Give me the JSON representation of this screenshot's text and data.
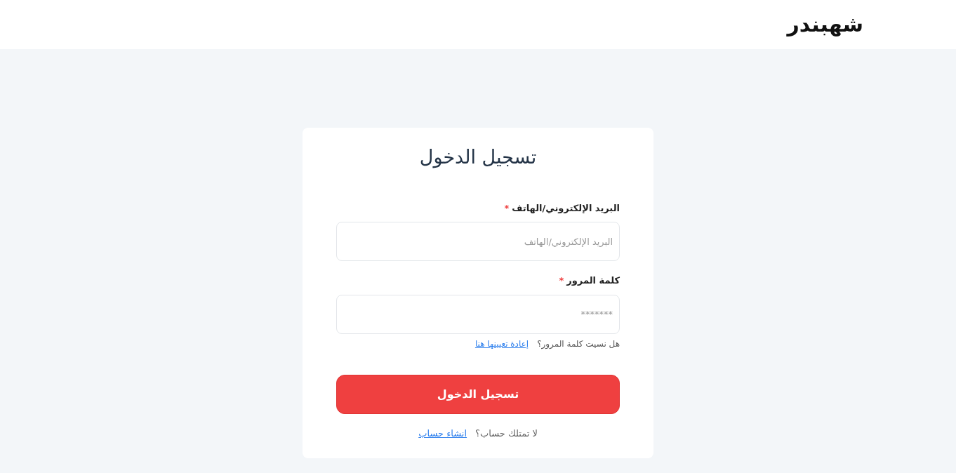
{
  "header": {
    "logo": "شهبندر"
  },
  "login": {
    "title": "تسجيل الدخول",
    "fields": [
      {
        "label": "البريد الإلكتروني/الهاتف",
        "required_mark": "*",
        "placeholder": "البريد الإلكتروني/الهاتف"
      },
      {
        "label": "كلمة المرور",
        "required_mark": "*",
        "placeholder": "*******"
      }
    ],
    "forgot": {
      "text": "هل نسيت كلمة المرور؟",
      "link": "إعادة تعيينها هنا"
    },
    "submit": "تسجيل الدخول",
    "signup": {
      "text": "لا تمتلك حساب؟",
      "link": "انشاء حساب"
    }
  }
}
